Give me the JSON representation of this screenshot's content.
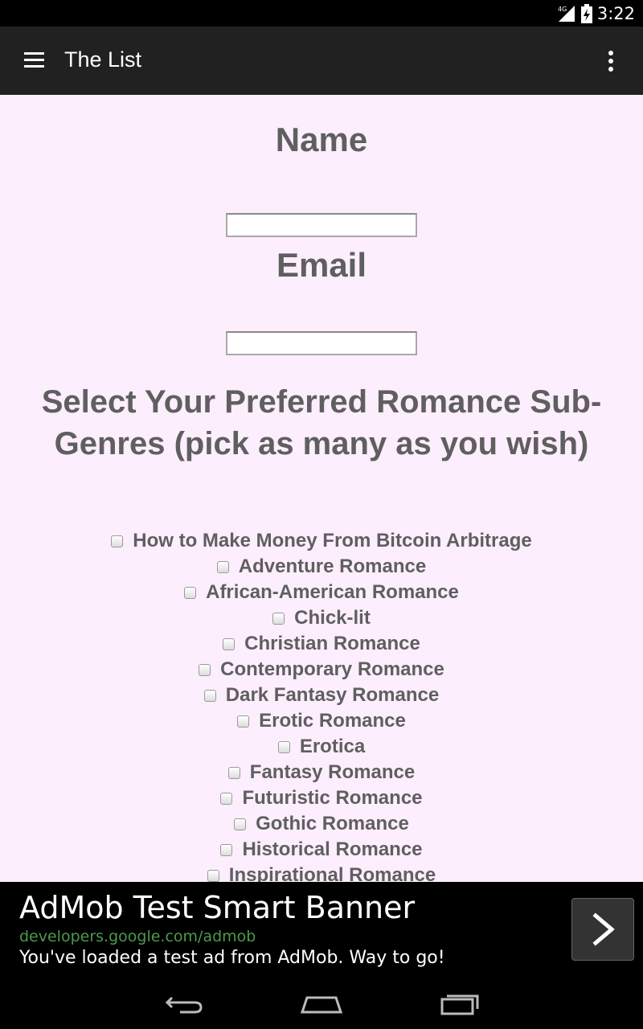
{
  "status_bar": {
    "network": "4G",
    "time": "3:22"
  },
  "app_bar": {
    "title": "The List",
    "menu_icon": "hamburger-menu-icon",
    "overflow_icon": "more-vertical-icon"
  },
  "form": {
    "name_label": "Name",
    "name_value": "",
    "email_label": "Email",
    "email_value": "",
    "genres_heading": "Select Your Preferred Romance Sub-Genres (pick as many as you wish)",
    "genres": [
      {
        "label": "How to Make Money From Bitcoin Arbitrage",
        "checked": false
      },
      {
        "label": "Adventure Romance",
        "checked": false
      },
      {
        "label": "African-American Romance",
        "checked": false
      },
      {
        "label": "Chick-lit",
        "checked": false
      },
      {
        "label": "Christian Romance",
        "checked": false
      },
      {
        "label": "Contemporary Romance",
        "checked": false
      },
      {
        "label": "Dark Fantasy Romance",
        "checked": false
      },
      {
        "label": "Erotic Romance",
        "checked": false
      },
      {
        "label": "Erotica",
        "checked": false
      },
      {
        "label": "Fantasy Romance",
        "checked": false
      },
      {
        "label": "Futuristic Romance",
        "checked": false
      },
      {
        "label": "Gothic Romance",
        "checked": false
      },
      {
        "label": "Historical Romance",
        "checked": false
      },
      {
        "label": "Inspirational Romance",
        "checked": false
      }
    ]
  },
  "ad": {
    "title": "AdMob Test Smart Banner",
    "url": "developers.google.com/admob",
    "description": "You've loaded a test ad from AdMob. Way to go!",
    "button_icon": "chevron-right-icon"
  },
  "nav_bar": {
    "back_icon": "back-icon",
    "home_icon": "home-icon",
    "recents_icon": "recent-apps-icon"
  },
  "colors": {
    "content_background": "#fdeefe",
    "app_bar": "#212121",
    "text": "#5f5f5f",
    "ad_url": "#4c9a4a"
  }
}
